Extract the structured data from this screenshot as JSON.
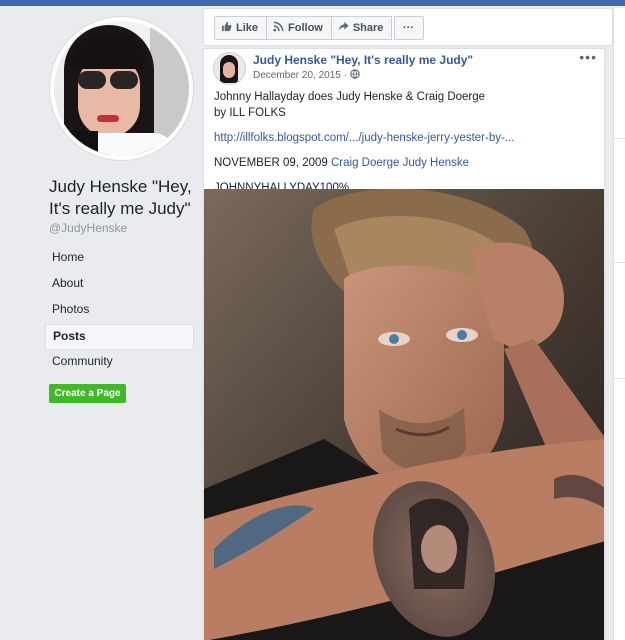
{
  "page": {
    "name": "Judy Henske \"Hey, It's really me Judy\"",
    "handle": "@JudyHenske"
  },
  "nav": {
    "items": [
      "Home",
      "About",
      "Photos",
      "Posts",
      "Community"
    ],
    "active": "Posts"
  },
  "create_page_label": "Create a Page",
  "actions": {
    "like": "Like",
    "follow": "Follow",
    "share": "Share",
    "more": "···"
  },
  "post": {
    "author": "Judy Henske \"Hey, It's really me Judy\"",
    "date": "December 20, 2015 ·",
    "more": "•••",
    "line1": "Johnny Hallayday does Judy Henske & Craig Doerge",
    "line2_prefix": "by ",
    "line2_name": "ILL FOLKS",
    "link": "http://illfolks.blogspot.com/.../judy-henske-jerry-yester-by-...",
    "date_line_prefix": "NOVEMBER 09, 2009 ",
    "date_line_tags": "Craig Doerge Judy Henske",
    "hashtag_line": "JOHNNYHALLYDAY100%"
  },
  "colors": {
    "brand_blue": "#4267b2",
    "link_blue": "#365899",
    "create_green": "#42b72a",
    "background": "#e9ebee"
  },
  "icons": {
    "like": "thumbs-up-icon",
    "follow": "rss-icon",
    "share": "share-arrow-icon",
    "privacy": "globe-icon"
  }
}
